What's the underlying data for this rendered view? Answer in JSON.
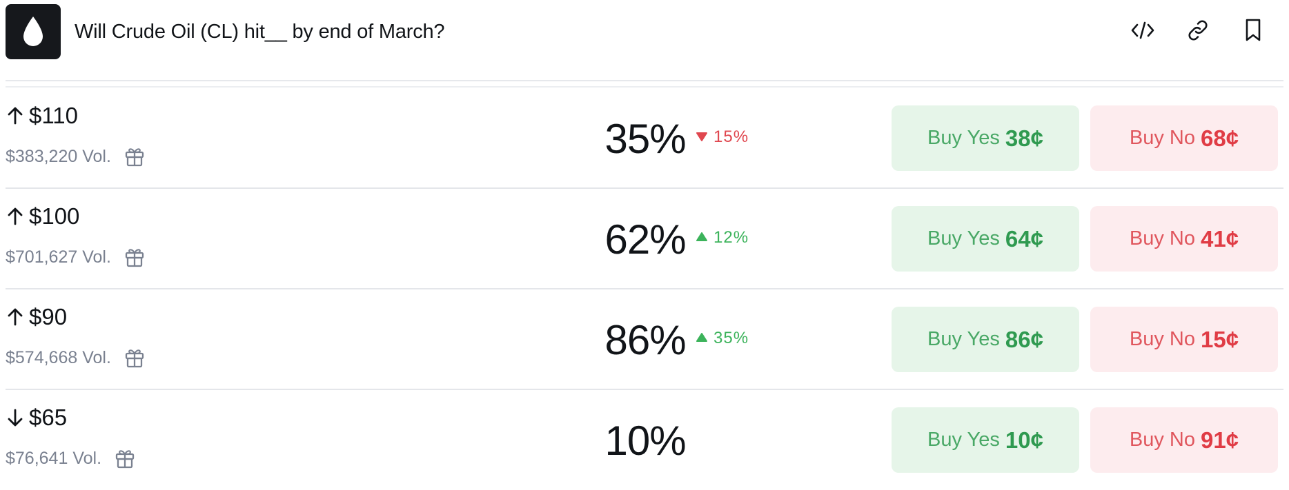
{
  "header": {
    "title": "Will Crude Oil (CL) hit__ by end of March?",
    "logo_icon": "oil-drop-icon",
    "actions": [
      {
        "name": "embed-code-button",
        "icon": "code-icon"
      },
      {
        "name": "copy-link-button",
        "icon": "link-icon"
      },
      {
        "name": "bookmark-button",
        "icon": "bookmark-icon"
      }
    ]
  },
  "colors": {
    "yes_bg": "#e6f5e9",
    "yes_text": "#2f9a50",
    "no_bg": "#fdecee",
    "no_text": "#e03c45",
    "change_down": "#e0474f",
    "change_up": "#3cb35b"
  },
  "markets": [
    {
      "direction": "up",
      "price": "$110",
      "volume": "$383,220 Vol.",
      "probability": "35%",
      "change": "15%",
      "change_direction": "down",
      "yes_label": "Buy Yes",
      "yes_price": "38¢",
      "no_label": "Buy No",
      "no_price": "68¢"
    },
    {
      "direction": "up",
      "price": "$100",
      "volume": "$701,627 Vol.",
      "probability": "62%",
      "change": "12%",
      "change_direction": "up",
      "yes_label": "Buy Yes",
      "yes_price": "64¢",
      "no_label": "Buy No",
      "no_price": "41¢"
    },
    {
      "direction": "up",
      "price": "$90",
      "volume": "$574,668 Vol.",
      "probability": "86%",
      "change": "35%",
      "change_direction": "up",
      "yes_label": "Buy Yes",
      "yes_price": "86¢",
      "no_label": "Buy No",
      "no_price": "15¢"
    },
    {
      "direction": "down",
      "price": "$65",
      "volume": "$76,641 Vol.",
      "probability": "10%",
      "change": "",
      "change_direction": "none",
      "yes_label": "Buy Yes",
      "yes_price": "10¢",
      "no_label": "Buy No",
      "no_price": "91¢"
    }
  ]
}
